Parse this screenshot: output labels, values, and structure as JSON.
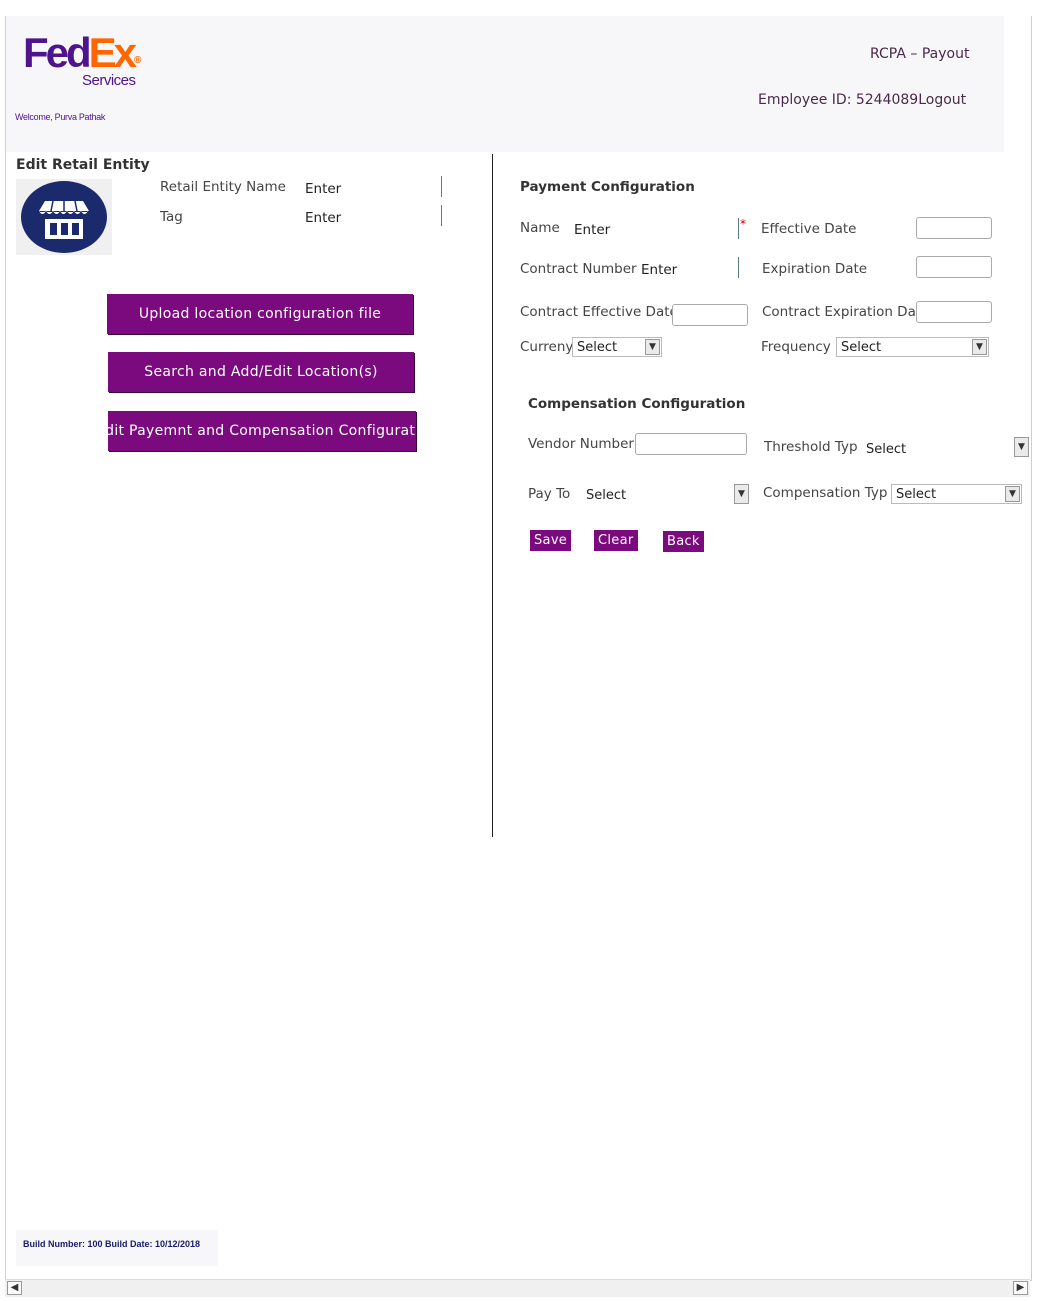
{
  "header": {
    "logo_fed": "Fed",
    "logo_ex": "Ex",
    "logo_services": "Services",
    "welcome": "Welcome, Purva Pathak",
    "app_title": "RCPA – Payout",
    "employee_id": "Employee ID: 5244089",
    "logout": "Logout"
  },
  "left": {
    "title": "Edit Retail Entity",
    "entity_name_label": "Retail Entity Name",
    "entity_name_value": "Enter",
    "tag_label": "Tag",
    "tag_value": "Enter",
    "avatar_icon": "store-icon",
    "buttons": {
      "upload": "Upload location configuration file",
      "search": "Search and Add/Edit Location(s)",
      "edit_payment": "Edit Payemnt and Compensation Configuration"
    }
  },
  "payment": {
    "title": "Payment Configuration",
    "name_label": "Name",
    "name_value": "Enter",
    "required_mark": "*",
    "effective_date_label": "Effective Date",
    "contract_number_label": "Contract Number",
    "contract_number_value": "Enter",
    "expiration_date_label": "Expiration Date",
    "contract_effective_label": "Contract Effective Date",
    "contract_expiration_label": "Contract Expiration Da",
    "currency_label": "Curreny",
    "currency_value": "Select",
    "frequency_label": "Frequency",
    "frequency_value": "Select"
  },
  "compensation": {
    "title": "Compensation Configuration",
    "vendor_number_label": "Vendor Number",
    "threshold_label": "Threshold Typ",
    "threshold_value": "Select",
    "pay_to_label": "Pay To",
    "pay_to_value": "Select",
    "compensation_type_label": "Compensation Typ",
    "compensation_type_value": "Select"
  },
  "actions": {
    "save": "Save",
    "clear": "Clear",
    "back": "Back"
  },
  "footer": {
    "build": "Build Number: 100 Build Date: 10/12/2018"
  },
  "colors": {
    "brand_purple": "#4d148c",
    "brand_orange": "#ff6600",
    "button_purple": "#7a0a7e"
  }
}
